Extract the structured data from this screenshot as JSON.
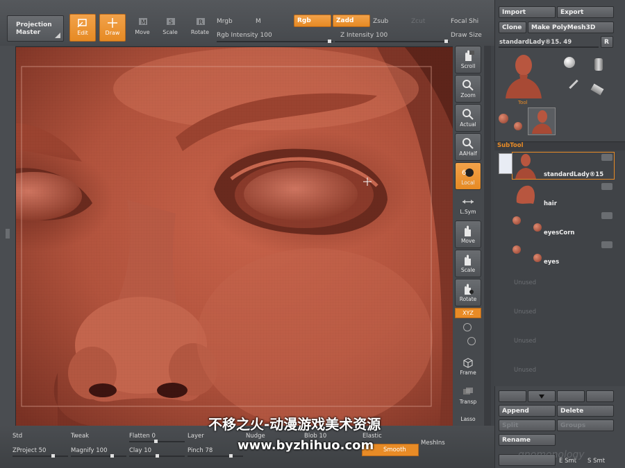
{
  "toolbar": {
    "projection_master": "Projection\nMaster",
    "edit": "Edit",
    "draw": "Draw",
    "move": "Move",
    "scale": "Scale",
    "rotate": "Rotate",
    "mrgb": "Mrgb",
    "rgb": "Rgb",
    "m": "M",
    "zadd": "Zadd",
    "zsub": "Zsub",
    "zcut": "Zcut",
    "focal_shift": "Focal Shi",
    "draw_size": "Draw Size",
    "rgb_intensity": "Rgb Intensity 100",
    "z_intensity": "Z Intensity 100",
    "rgb_intensity_value": 100,
    "z_intensity_value": 100
  },
  "right_dock": {
    "scroll": "Scroll",
    "zoom": "Zoom",
    "actual": "Actual",
    "aahalf": "AAHalf",
    "local": "Local",
    "lsym": "L.Sym",
    "move": "Move",
    "scale": "Scale",
    "rotate": "Rotate",
    "xyz": "XYZ",
    "frame": "Frame",
    "transp": "Transp",
    "lasso": "Lasso"
  },
  "tool_panel": {
    "import": "Import",
    "export": "Export",
    "clone": "Clone",
    "make_polymesh": "Make PolyMesh3D",
    "current_tool": "standardLady®15. 49",
    "r": "R",
    "tool_label": "Tool"
  },
  "subtool": {
    "header": "SubTool",
    "items": [
      {
        "name": "standardLady®15",
        "selected": true
      },
      {
        "name": "hair"
      },
      {
        "name": "eyesCorn"
      },
      {
        "name": "eyes"
      },
      {
        "name": "Unused"
      },
      {
        "name": "Unused"
      },
      {
        "name": "Unused"
      },
      {
        "name": "Unused"
      }
    ],
    "append": "Append",
    "delete": "Delete",
    "split": "Split",
    "groups": "Groups",
    "rename": "Rename",
    "e_smt": "E Smt",
    "s_smt": "S Smt"
  },
  "brushes": {
    "std": "Std",
    "tweak": "Tweak",
    "flatten": "Flatten 0",
    "layer": "Layer",
    "nudge": "Nudge",
    "elastic": "Elastic",
    "zproject": "ZProject 50",
    "magnify": "Magnify 100",
    "clay": "Clay 10",
    "pinch": "Pinch 78",
    "blob": "Blob 10",
    "meshins": "MeshIns",
    "smooth": "Smooth"
  },
  "watermark": {
    "cn": "不移之火-动漫游戏美术资源",
    "url": "www.byzhihuo.com",
    "brand": "gnomonology"
  },
  "colors": {
    "accent": "#e88b26",
    "skin": "#b8563f"
  }
}
